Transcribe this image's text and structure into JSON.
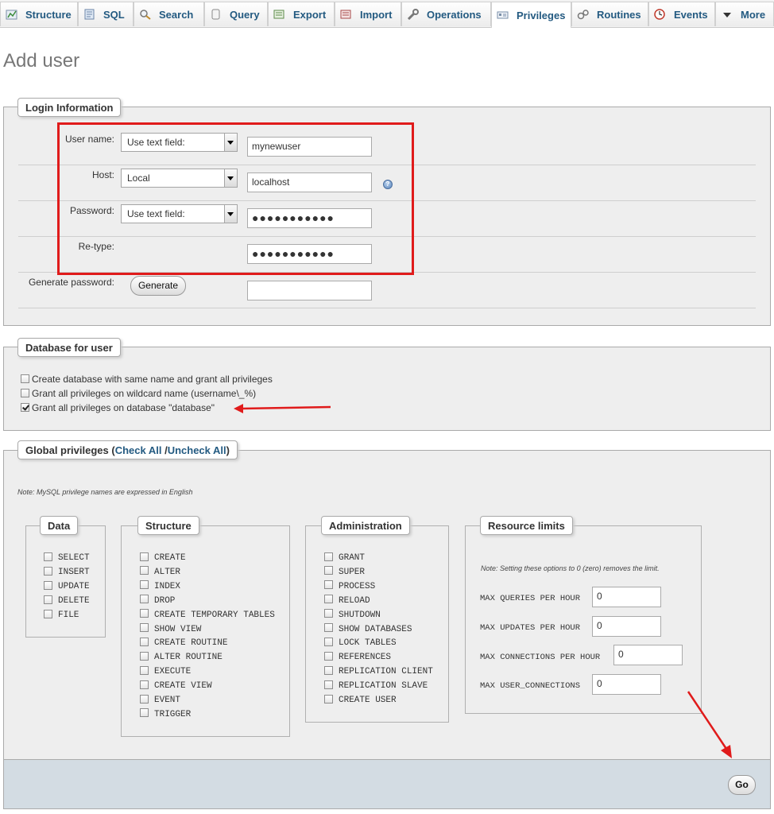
{
  "tabs": [
    {
      "label": "Structure",
      "icon": "structure-icon"
    },
    {
      "label": "SQL",
      "icon": "sql-icon"
    },
    {
      "label": "Search",
      "icon": "search-icon"
    },
    {
      "label": "Query",
      "icon": "query-icon"
    },
    {
      "label": "Export",
      "icon": "export-icon"
    },
    {
      "label": "Import",
      "icon": "import-icon"
    },
    {
      "label": "Operations",
      "icon": "wrench-icon"
    },
    {
      "label": "Privileges",
      "icon": "privileges-icon",
      "active": true
    },
    {
      "label": "Routines",
      "icon": "routines-icon"
    },
    {
      "label": "Events",
      "icon": "clock-icon"
    },
    {
      "label": "More",
      "icon": "chevron-down-icon"
    }
  ],
  "page_title": "Add user",
  "login": {
    "legend": "Login Information",
    "username_label": "User name:",
    "username_mode": "Use text field:",
    "username_value": "mynewuser",
    "host_label": "Host:",
    "host_mode": "Local",
    "host_value": "localhost",
    "password_label": "Password:",
    "password_mode": "Use text field:",
    "password_value": "●●●●●●●●●●●",
    "retype_label": "Re-type:",
    "retype_value": "●●●●●●●●●●●",
    "generate_label": "Generate password:",
    "generate_button": "Generate",
    "generated_value": ""
  },
  "database": {
    "legend": "Database for user",
    "options": [
      {
        "label": "Create database with same name and grant all privileges",
        "checked": false
      },
      {
        "label": "Grant all privileges on wildcard name (username\\_%)",
        "checked": false
      },
      {
        "label": "Grant all privileges on database \"database\"",
        "checked": true
      }
    ]
  },
  "global": {
    "legend_prefix": "Global privileges (",
    "check_all": "Check All",
    "separator": " /",
    "uncheck_all": "Uncheck All",
    "legend_suffix": ")",
    "note": "Note: MySQL privilege names are expressed in English",
    "data_legend": "Data",
    "data": [
      "SELECT",
      "INSERT",
      "UPDATE",
      "DELETE",
      "FILE"
    ],
    "structure_legend": "Structure",
    "structure": [
      "CREATE",
      "ALTER",
      "INDEX",
      "DROP",
      "CREATE TEMPORARY TABLES",
      "SHOW VIEW",
      "CREATE ROUTINE",
      "ALTER ROUTINE",
      "EXECUTE",
      "CREATE VIEW",
      "EVENT",
      "TRIGGER"
    ],
    "admin_legend": "Administration",
    "admin": [
      "GRANT",
      "SUPER",
      "PROCESS",
      "RELOAD",
      "SHUTDOWN",
      "SHOW DATABASES",
      "LOCK TABLES",
      "REFERENCES",
      "REPLICATION CLIENT",
      "REPLICATION SLAVE",
      "CREATE USER"
    ],
    "resource_legend": "Resource limits",
    "resource_note": "Note: Setting these options to 0 (zero) removes the limit.",
    "resource": [
      {
        "label": "MAX QUERIES PER HOUR",
        "value": "0"
      },
      {
        "label": "MAX UPDATES PER HOUR",
        "value": "0"
      },
      {
        "label": "MAX CONNECTIONS PER HOUR",
        "value": "0"
      },
      {
        "label": "MAX USER_CONNECTIONS",
        "value": "0"
      }
    ]
  },
  "footer": {
    "go_button": "Go"
  },
  "colors": {
    "accent": "#235a81",
    "annotation_red": "#e01b1b",
    "fieldset_bg": "#eeeeee",
    "footer_bg": "#d3dce3"
  }
}
